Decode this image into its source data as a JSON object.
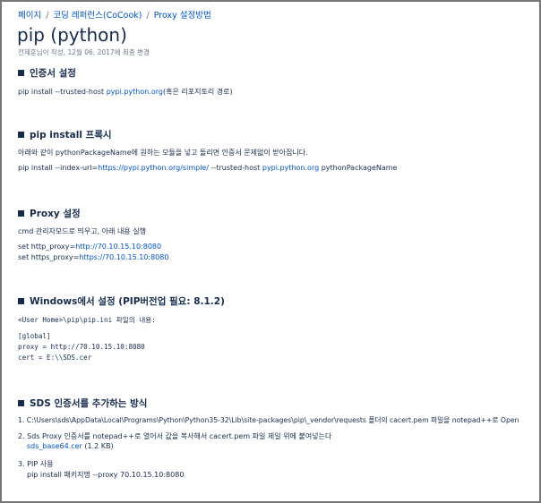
{
  "breadcrumb": {
    "items": [
      "페이지",
      "코딩 레퍼런스(CoCook)",
      "Proxy 설정방법"
    ],
    "separator": "/"
  },
  "page": {
    "title": "pip (python)",
    "byline": "전제훈님이 작성, 12월 06, 2017에 최종 변경"
  },
  "sections": {
    "cert": {
      "heading": "인증서 설정",
      "line_pre": "pip install --trusted-host ",
      "line_link": "pypi.python.org",
      "line_post": "(혹은 리포지토리 경로)"
    },
    "pipproxy": {
      "heading": "pip install 프록시",
      "desc": "아래와 같이 pythonPackageName에 원하는 모듈을 넣고 돌리면 인증서 문제없이 받아집니다.",
      "cmd_pre": "pip install --index-url=",
      "cmd_link1": "https://pypi.python.org/simple/",
      "cmd_mid": " --trusted-host ",
      "cmd_link2": "pypi.python.org",
      "cmd_post": " pythonPackageName"
    },
    "proxy": {
      "heading": "Proxy 설정",
      "desc": "cmd 관리자모드로 띄우고, 아래 내용 실행",
      "line1_pre": "set http_proxy=",
      "line1_link": "http://70.10.15.10:8080",
      "line2_pre": "set https_proxy=",
      "line2_link": "https://70.10.15.10:8080"
    },
    "windows": {
      "heading": "Windows에서 설정 (PIP버전업 필요: 8.1.2)",
      "path_line": "<User Home>\\pip\\pip.ini 파일의 내용:",
      "code1": "[global]",
      "code2": "proxy = http://70.10.15.10:8080",
      "code3": "cert = E:\\\\SDS.cer"
    },
    "sds": {
      "heading": "SDS 인증서를 추가하는 방식",
      "item1": "1. C:\\Users\\sds\\AppData\\Local\\Programs\\Python\\Python35-32\\Lib\\site-packages\\pip\\_vendor\\requests 폴더의 cacert.pem 파일을 notepad++로 Open",
      "item2": "2. Sds Proxy 인증서를 notepad++로 열어서 값을 복사해서 cacert.pem 파일 제일 위에 붙여넣는다",
      "attachment_name": "sds_base64.cer",
      "attachment_size": " (1.2 KB)",
      "item3": "3. PIP 사용",
      "item3_cmd": "pip install 패키지명 --proxy 70.10.15.10:8080"
    }
  },
  "colors": {
    "link": "#0052cc",
    "text": "#172b4d",
    "muted": "#6b778c",
    "frame_border": "#777777"
  }
}
